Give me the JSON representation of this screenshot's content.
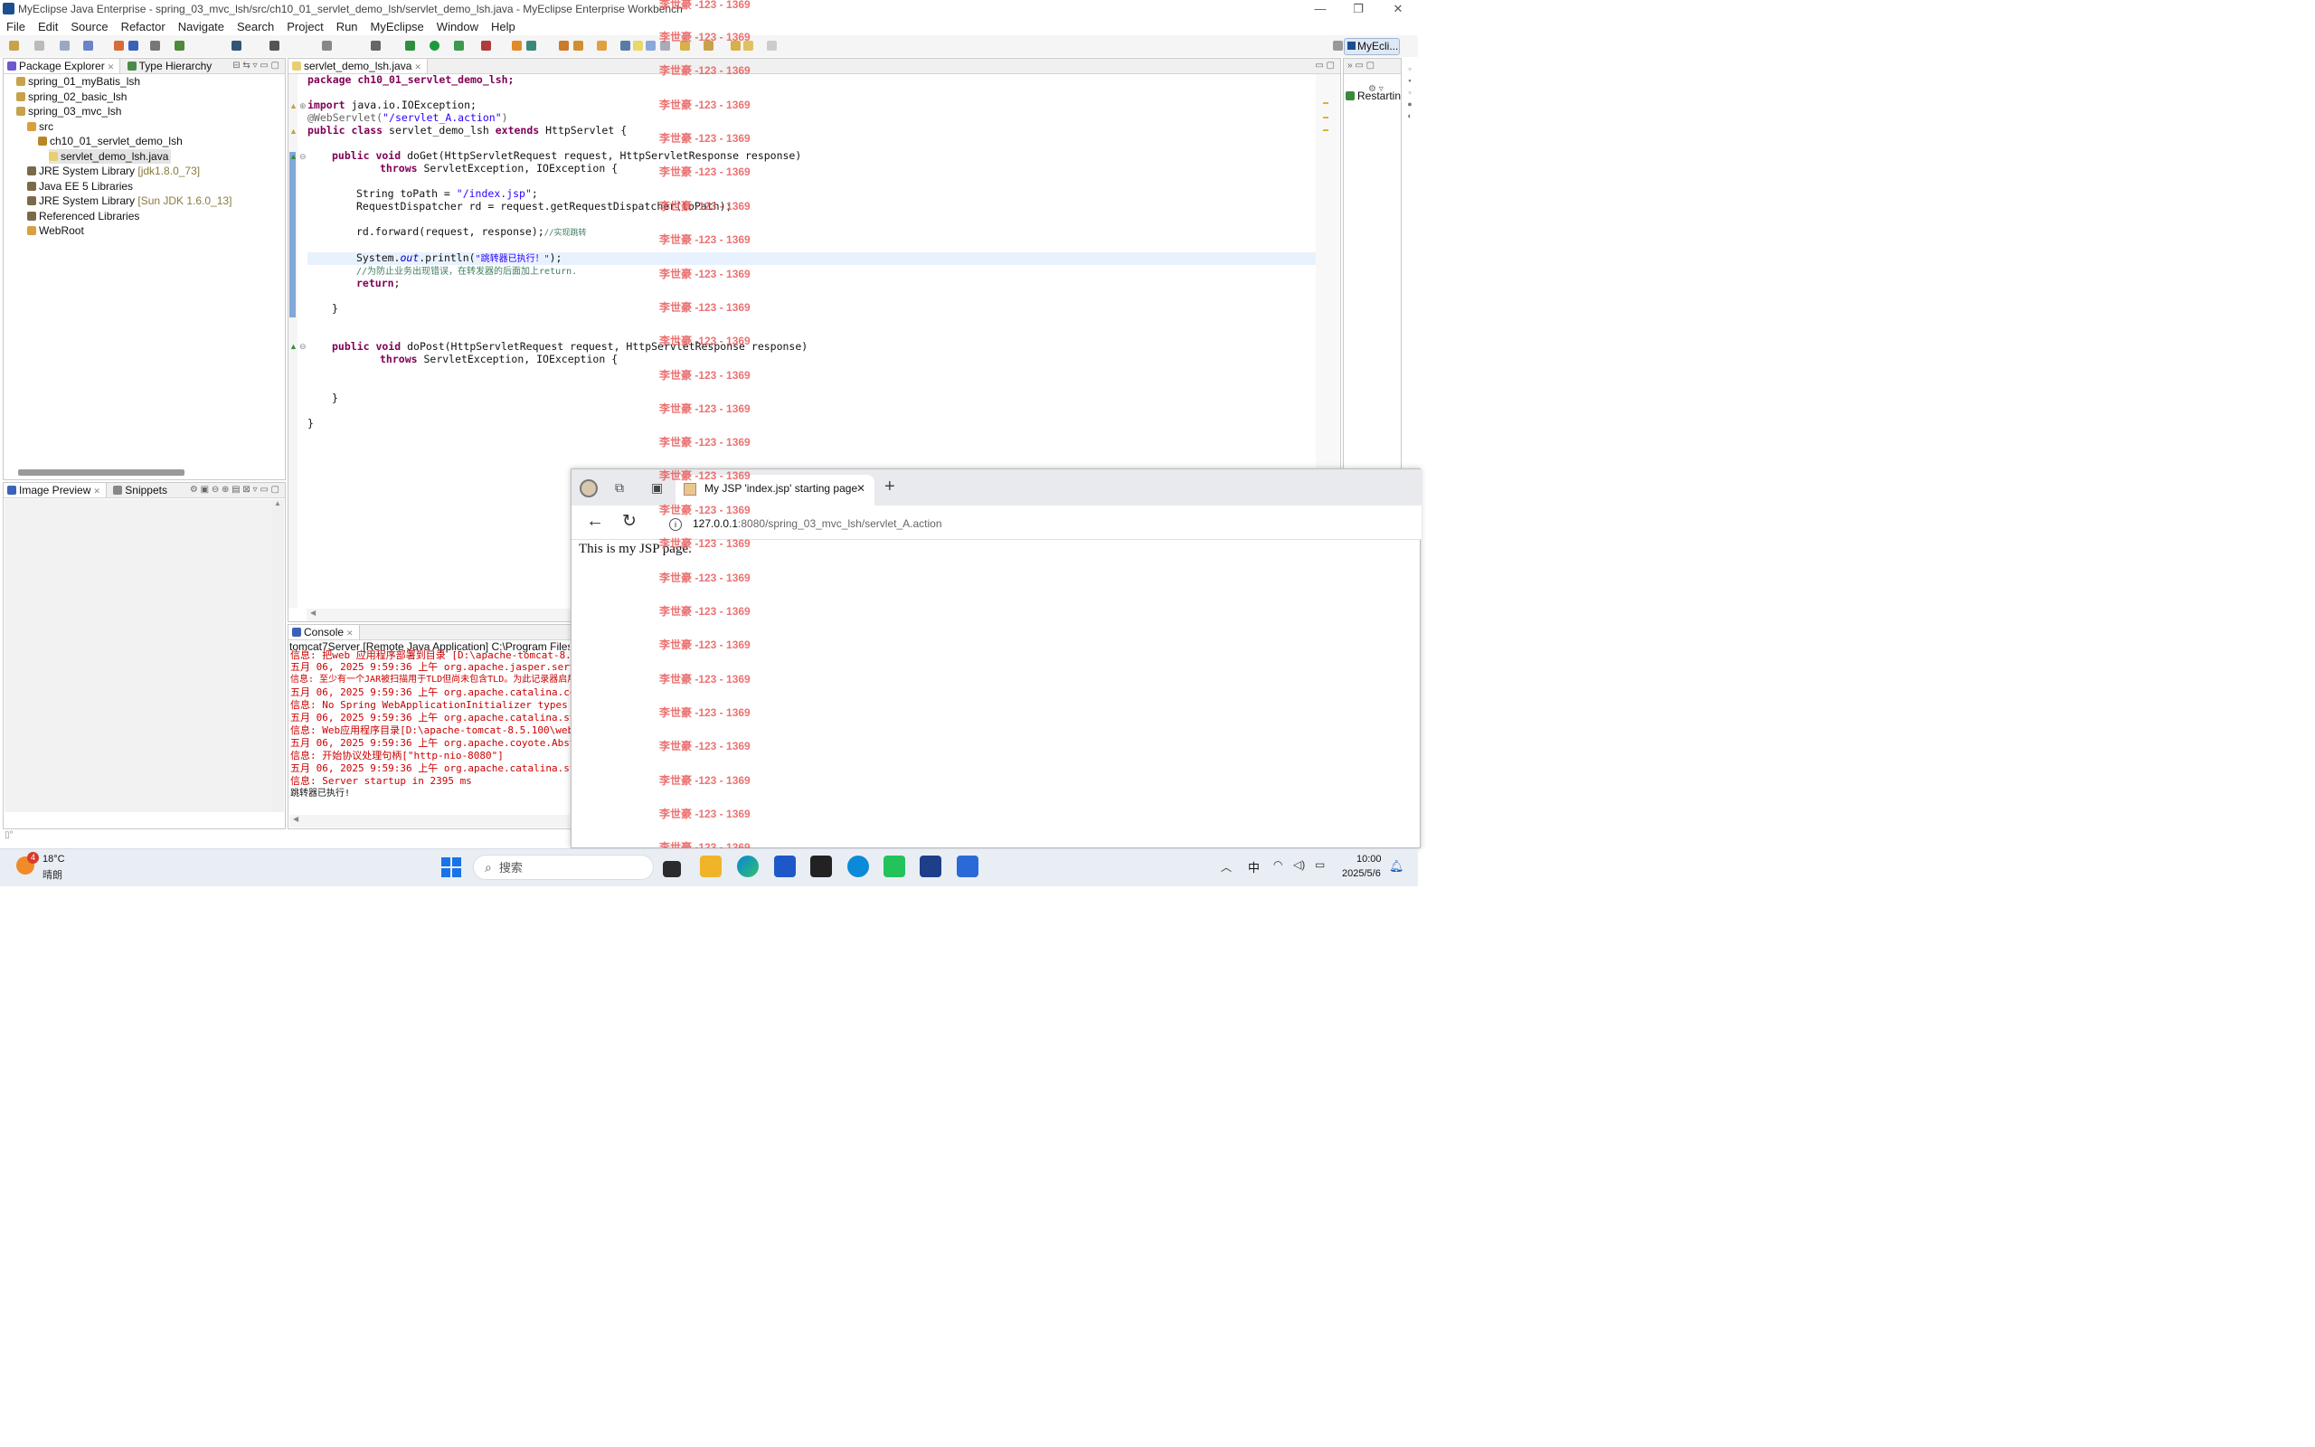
{
  "window": {
    "title": "MyEclipse Java Enterprise - spring_03_mvc_lsh/src/ch10_01_servlet_demo_lsh/servlet_demo_lsh.java - MyEclipse Enterprise Workbench",
    "minimize": "—",
    "maximize": "❐",
    "close": "✕"
  },
  "menu": [
    "File",
    "Edit",
    "Source",
    "Refactor",
    "Navigate",
    "Search",
    "Project",
    "Run",
    "MyEclipse",
    "Window",
    "Help"
  ],
  "perspective": {
    "label": "MyEcli..."
  },
  "package_explorer": {
    "tab_label": "Package Explorer",
    "tab2_label": "Type Hierarchy",
    "items": [
      {
        "label": "spring_01_myBatis_lsh",
        "extra": ""
      },
      {
        "label": "spring_02_basic_lsh",
        "extra": ""
      },
      {
        "label": "spring_03_mvc_lsh",
        "extra": ""
      },
      {
        "label": "src",
        "extra": ""
      },
      {
        "label": "ch10_01_servlet_demo_lsh",
        "extra": ""
      },
      {
        "label": "servlet_demo_lsh.java",
        "extra": ""
      },
      {
        "label": "JRE System Library",
        "extra": "[jdk1.8.0_73]"
      },
      {
        "label": "Java EE 5 Libraries",
        "extra": ""
      },
      {
        "label": "JRE System Library",
        "extra": "[Sun JDK 1.6.0_13]"
      },
      {
        "label": "Referenced Libraries",
        "extra": ""
      },
      {
        "label": "WebRoot",
        "extra": ""
      }
    ]
  },
  "image_preview": {
    "tab_label": "Image Preview",
    "tab2_label": "Snippets"
  },
  "editor": {
    "tab_label": "servlet_demo_lsh.java",
    "lines": {
      "l1": "package ch10_01_servlet_demo_lsh;",
      "l2_kw": "import",
      "l2": " java.io.IOException;",
      "l3_ann": "@WebServlet(",
      "l3_str": "\"/servlet_A.action\"",
      "l3_end": ")",
      "l4_kw": "public class",
      "l4_name": " servlet_demo_lsh ",
      "l4_kw2": "extends",
      "l4_end": " HttpServlet {",
      "l5_kw": "public void",
      "l5": " doGet(HttpServletRequest request, HttpServletResponse response)",
      "l6_kw": "throws",
      "l6": " ServletException, IOException {",
      "l7": "String toPath = ",
      "l7_str": "\"/index.jsp\"",
      "l7_end": ";",
      "l8": "RequestDispatcher rd = request.getRequestDispatcher(toPath);",
      "l9": "rd.forward(request, response);",
      "l9_cmt": "//实现跳转",
      "l10": "System.",
      "l10_fld": "out",
      "l10_b": ".println(",
      "l10_str": "\"跳转器已执行！\"",
      "l10_end": ");",
      "l11_cmt": "//为防止业务出现错误，在转发器的后面加上return.",
      "l12_kw": "return",
      "l12_end": ";",
      "l13": "}",
      "l14_kw": "public void",
      "l14": " doPost(HttpServletRequest request, HttpServletResponse response)",
      "l15_kw": "throws",
      "l15": " ServletException, IOException {",
      "l16": "}",
      "l17": "}"
    }
  },
  "right_panel": {
    "label": "Restartin"
  },
  "console": {
    "tab_label": "Console",
    "header": "tomcat7Server [Remote Java Application] C:\\Program Files (",
    "lines": [
      "信息: 把web 应用程序部署到目录 [D:\\apache-tomcat-8.5.1",
      "五月 06, 2025 9:59:36 上午 org.apache.jasper.servl",
      "信息: 至少有一个JAR被扫描用于TLD但尚未包含TLD。为此记录器启用",
      "五月 06, 2025 9:59:36 上午 org.apache.catalina.cor",
      "信息: No Spring WebApplicationInitializer types",
      "五月 06, 2025 9:59:36 上午 org.apache.catalina.sta",
      "信息: Web应用程序目录[D:\\apache-tomcat-8.5.100\\weba",
      "五月 06, 2025 9:59:36 上午 org.apache.coyote.Abstr",
      "信息: 开始协议处理句柄[\"http-nio-8080\"]",
      "五月 06, 2025 9:59:36 上午 org.apache.catalina.sta",
      "信息: Server startup in 2395 ms",
      "跳转器已执行!"
    ]
  },
  "browser": {
    "tab_title": "My JSP 'index.jsp' starting page",
    "url_host": "127.0.0.1",
    "url_rest": ":8080/spring_03_mvc_lsh/servlet_A.action",
    "page_text": "This is my JSP page."
  },
  "watermark": "李世豪 -123 - 1369",
  "taskbar": {
    "weather_badge": "4",
    "temp": "18°C",
    "condition": "晴朗",
    "search_placeholder": "搜索",
    "ime": "中",
    "time": "10:00",
    "date": "2025/5/6"
  },
  "colors": {
    "keyword": "#7f0055",
    "string": "#2a00ff",
    "comment": "#3f7f5f",
    "accent": "#0a64d6"
  }
}
